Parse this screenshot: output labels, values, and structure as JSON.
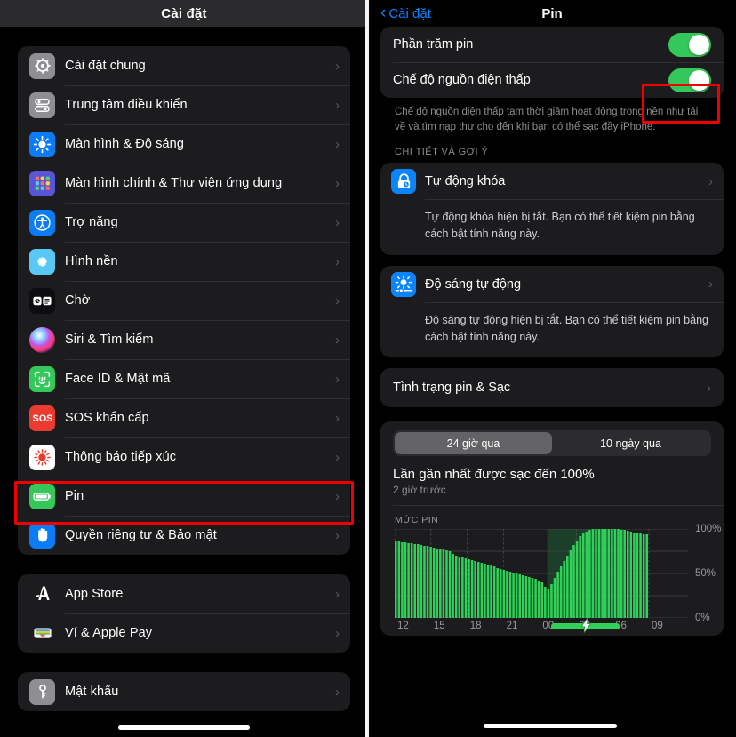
{
  "left_panel": {
    "header_title": "Cài đặt",
    "groups": [
      {
        "items": [
          {
            "label": "Cài đặt chung",
            "icon": "gear-icon",
            "icon_bg": "#8e8e93"
          },
          {
            "label": "Trung tâm điều khiển",
            "icon": "control-center-icon",
            "icon_bg": "#8e8e93"
          },
          {
            "label": "Màn hình & Độ sáng",
            "icon": "brightness-icon",
            "icon_bg": "#0a7cf5"
          },
          {
            "label": "Màn hình chính & Thư viện ứng dụng",
            "icon": "home-screen-icon",
            "icon_bg": "#5856d6"
          },
          {
            "label": "Trợ năng",
            "icon": "accessibility-icon",
            "icon_bg": "#0a7cf5"
          },
          {
            "label": "Hình nền",
            "icon": "wallpaper-icon",
            "icon_bg": "#5ac8f5"
          },
          {
            "label": "Chờ",
            "icon": "standby-icon",
            "icon_bg": "#1c1c1e"
          },
          {
            "label": "Siri & Tìm kiếm",
            "icon": "siri-icon",
            "icon_bg": "#d13b8f"
          },
          {
            "label": "Face ID & Mật mã",
            "icon": "face-id-icon",
            "icon_bg": "#34c759"
          },
          {
            "label": "SOS khẩn cấp",
            "icon": "sos-icon",
            "icon_bg": "#eb3b30"
          },
          {
            "label": "Thông báo tiếp xúc",
            "icon": "exposure-notification-icon",
            "icon_bg": "#ffffff"
          },
          {
            "label": "Pin",
            "icon": "battery-icon",
            "icon_bg": "#34c759"
          },
          {
            "label": "Quyền riêng tư & Bảo mật",
            "icon": "privacy-hand-icon",
            "icon_bg": "#0a7cf5"
          }
        ]
      },
      {
        "items": [
          {
            "label": "App Store",
            "icon": "app-store-icon",
            "icon_bg": "#0a84ff"
          },
          {
            "label": "Ví & Apple Pay",
            "icon": "wallet-icon",
            "icon_bg": "#1c1c1e"
          }
        ]
      },
      {
        "items": [
          {
            "label": "Mật khẩu",
            "icon": "key-icon",
            "icon_bg": "#8e8e93"
          }
        ]
      }
    ],
    "chevron": "›",
    "highlight_color": "#ee0000",
    "highlighted_item": "Pin"
  },
  "right_panel": {
    "back_label": "Cài đặt",
    "back_caret": "‹",
    "title": "Pin",
    "toggles": [
      {
        "label": "Phần trăm pin",
        "on": true,
        "highlighted": false
      },
      {
        "label": "Chế độ nguồn điện thấp",
        "on": true,
        "highlighted": true
      }
    ],
    "toggle_on_color": "#34c759",
    "footnote": "Chế độ nguồn điện thấp tạm thời giảm hoạt động trong nền như tải về và tìm nạp thư cho đến khi bạn có thể sạc đầy iPhone.",
    "suggestions_header": "CHI TIẾT VÀ GỢI Ý",
    "suggestions": [
      {
        "title": "Tự động khóa",
        "icon": "lock-clock-icon",
        "icon_bg": "#0a84ff",
        "body": "Tự động khóa hiện bị tắt. Bạn có thể tiết kiệm pin bằng cách bật tính năng này."
      },
      {
        "title": "Độ sáng tự động",
        "icon": "auto-brightness-icon",
        "icon_bg": "#0a84ff",
        "body": "Độ sáng tự động hiện bị tắt. Bạn có thể tiết kiệm pin bằng cách bật tính năng này."
      }
    ],
    "battery_health_row": "Tình trạng pin & Sạc",
    "usage": {
      "segments": [
        {
          "label": "24 giờ qua",
          "active": true
        },
        {
          "label": "10 ngày qua",
          "active": false
        }
      ],
      "last_charge_title": "Lần gần nhất được sạc đến 100%",
      "last_charge_sub": "2 giờ trước",
      "chart_section_label": "MỨC PIN"
    },
    "chevron": "›"
  },
  "chart_data": {
    "type": "bar",
    "title": "MỨC PIN",
    "xlabel": "",
    "ylabel": "",
    "ylim": [
      0,
      100
    ],
    "ytick_labels": [
      "0%",
      "50%",
      "100%"
    ],
    "ytick_values": [
      0,
      50,
      100
    ],
    "xtick_labels": [
      "12",
      "15",
      "18",
      "21",
      "00",
      "03",
      "06",
      "09"
    ],
    "grid": true,
    "legend": false,
    "bar_color": "#30d158",
    "charging_shade_color": "#1d5c33",
    "charging_indicator_color": "#30d158",
    "charging_bolt_glyph": "⚡",
    "charging_span_start_index": 48,
    "charging_span_end_index": 72,
    "values": [
      86,
      86,
      85,
      85,
      84,
      84,
      83,
      83,
      82,
      81,
      81,
      80,
      79,
      78,
      78,
      77,
      76,
      75,
      72,
      70,
      69,
      68,
      67,
      66,
      65,
      64,
      63,
      62,
      61,
      60,
      59,
      58,
      56,
      55,
      54,
      53,
      52,
      51,
      50,
      49,
      48,
      47,
      46,
      45,
      44,
      42,
      40,
      35,
      32,
      38,
      45,
      52,
      58,
      64,
      70,
      76,
      82,
      87,
      92,
      95,
      97,
      99,
      100,
      100,
      100,
      100,
      100,
      100,
      100,
      100,
      100,
      99,
      99,
      98,
      97,
      96,
      96,
      95,
      94,
      94
    ]
  }
}
